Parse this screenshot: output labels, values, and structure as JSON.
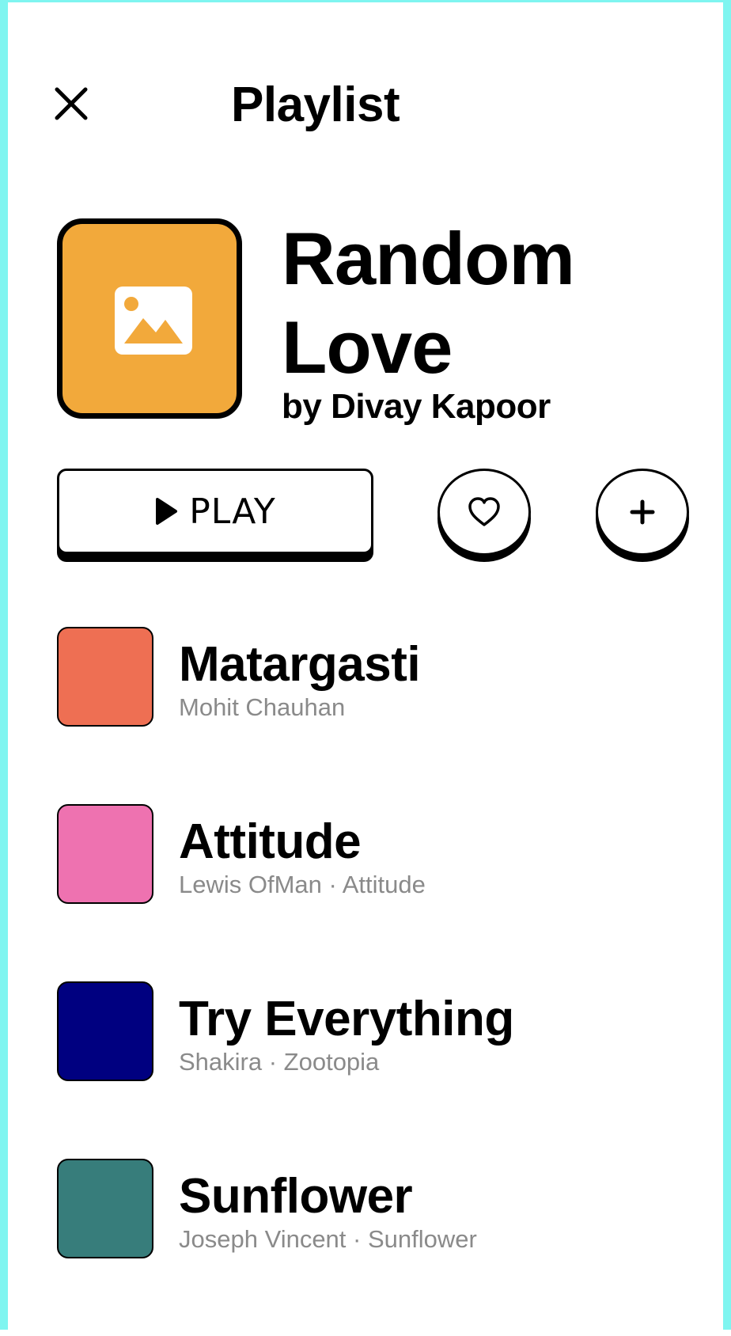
{
  "header": {
    "title": "Playlist",
    "close_icon": "close-icon"
  },
  "playlist": {
    "title": "Random Love",
    "owner": "by Divay Kapoor",
    "cover_color": "#f2a93b",
    "cover_icon": "image-placeholder-icon"
  },
  "actions": {
    "play_label": "PLAY",
    "play_icon": "play-icon",
    "like_icon": "heart-icon",
    "add_icon": "plus-icon"
  },
  "tracks": [
    {
      "name": "Matargasti",
      "subtitle": "Mohit Chauhan",
      "color": "#ee6f53"
    },
    {
      "name": "Attitude",
      "subtitle": "Lewis OfMan · Attitude",
      "color": "#ee72b0"
    },
    {
      "name": "Try Everything",
      "subtitle": "Shakira · Zootopia",
      "color": "#000080"
    },
    {
      "name": "Sunflower",
      "subtitle": "Joseph Vincent · Sunflower",
      "color": "#377d7b"
    }
  ]
}
